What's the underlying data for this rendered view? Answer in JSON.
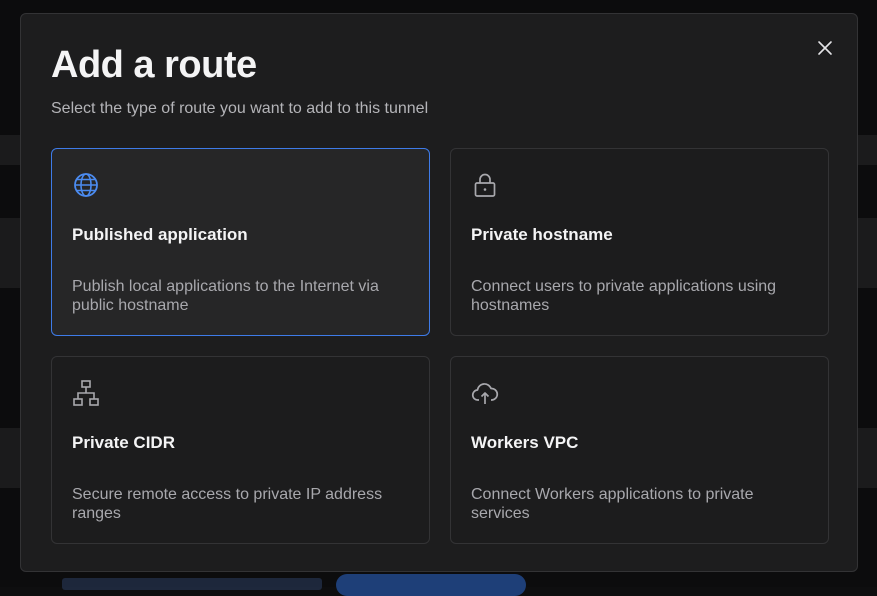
{
  "modal": {
    "title": "Add a route",
    "subtitle": "Select the type of route you want to add to this tunnel",
    "close_icon": "close-icon"
  },
  "route_options": [
    {
      "title": "Published application",
      "description": "Publish local applications to the Internet via public hostname",
      "icon": "globe-icon",
      "selected": true
    },
    {
      "title": "Private hostname",
      "description": "Connect users to private applications using hostnames",
      "icon": "lock-icon",
      "selected": false
    },
    {
      "title": "Private CIDR",
      "description": "Secure remote access to private IP address ranges",
      "icon": "network-icon",
      "selected": false
    },
    {
      "title": "Workers VPC",
      "description": "Connect Workers applications to private services",
      "icon": "cloud-upload-icon",
      "selected": false
    }
  ],
  "colors": {
    "accent": "#3e7be8",
    "modal_bg": "#1d1d1e",
    "card_border": "#333335"
  }
}
